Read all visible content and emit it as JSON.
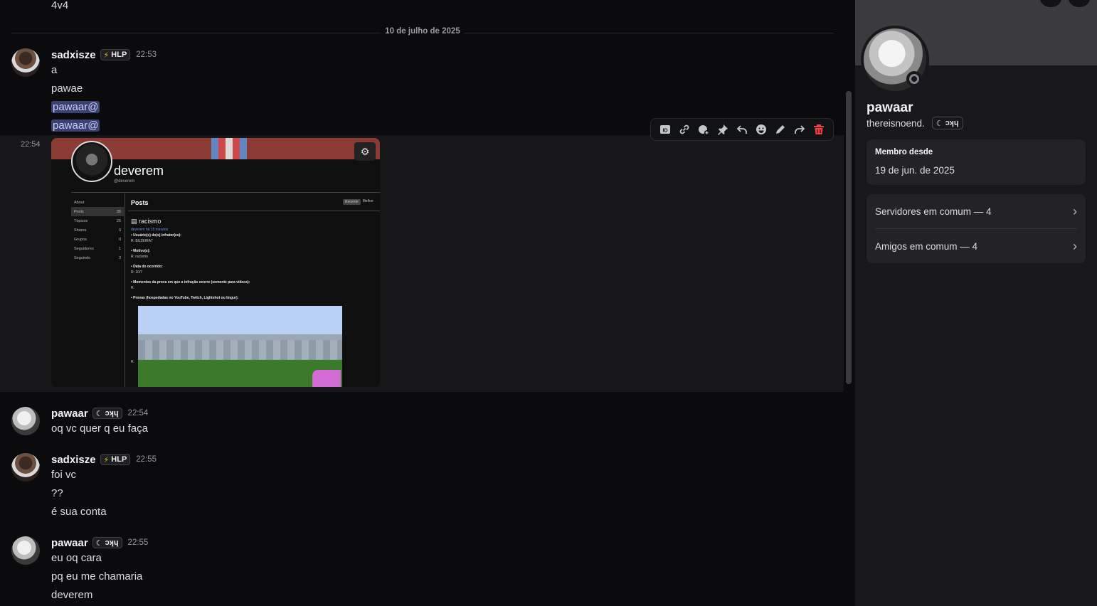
{
  "chat": {
    "top_line": "4v4",
    "date_divider": "10 de julho de 2025",
    "messages": [
      {
        "author": "sadxisze",
        "tag": "HLP",
        "time": "22:53",
        "lines": [
          "a",
          "pawae"
        ],
        "mentions": [
          "pawaar@",
          "pawaar@"
        ]
      },
      {
        "hover_time": "22:54",
        "embed": {
          "profile_name": "deverem",
          "profile_handle": "@deverem",
          "sidebar": [
            {
              "label": "About",
              "count": ""
            },
            {
              "label": "Posts",
              "count": "35"
            },
            {
              "label": "Tópicos",
              "count": "25"
            },
            {
              "label": "Shares",
              "count": "0"
            },
            {
              "label": "Grupos",
              "count": "0"
            },
            {
              "label": "Seguidores",
              "count": "1"
            },
            {
              "label": "Seguindo",
              "count": "3"
            }
          ],
          "section_title": "Posts",
          "sort_options": [
            "Recente",
            "Melhor"
          ],
          "post_title": "racismo",
          "post_meta": "deverem  há 15 minutos",
          "post_lines": [
            {
              "label": "• Usuário(s) do(s) infrator(es):",
              "value": "R: BUZEIRA7"
            },
            {
              "label": "• Motivo(s):",
              "value": "R: racismo"
            },
            {
              "label": "• Data do ocorrido:",
              "value": "R: 10/7"
            },
            {
              "label": "• Momentos da prova em que a infração ocorre (somente para vídeos):",
              "value": "R:"
            },
            {
              "label": "• Provas (hospedadas no YouTube, Twitch, Lightshot ou Imgur):",
              "value": "R:"
            }
          ]
        }
      },
      {
        "author": "pawaar",
        "tag": "ɔʞɥ",
        "time": "22:54",
        "lines": [
          "oq vc quer q eu faça"
        ]
      },
      {
        "author": "sadxisze",
        "tag": "HLP",
        "time": "22:55",
        "lines": [
          "foi vc",
          "??",
          "é sua conta"
        ]
      },
      {
        "author": "pawaar",
        "tag": "ɔʞɥ",
        "time": "22:55",
        "lines": [
          "eu oq cara",
          "pq eu me chamaria",
          "deverem"
        ]
      }
    ]
  },
  "toolbar": {
    "icons": [
      "id-icon",
      "link-icon",
      "add-reaction-icon",
      "pin-icon",
      "reply-icon",
      "emoji-icon",
      "edit-icon",
      "forward-icon",
      "delete-icon"
    ],
    "delete_color": "#f23f42"
  },
  "profile": {
    "display_name": "pawaar",
    "username": "thereisnoend.",
    "tag": "ɔʞɥ",
    "member_since_title": "Membro desde",
    "member_since_value": "19 de jun. de 2025",
    "mutual_servers": "Servidores em comum — 4",
    "mutual_friends": "Amigos em comum — 4"
  },
  "colors": {
    "mention_bg": "#3c4270",
    "hlp_bolt": "#f0b232",
    "status_offline": "#80848e"
  }
}
